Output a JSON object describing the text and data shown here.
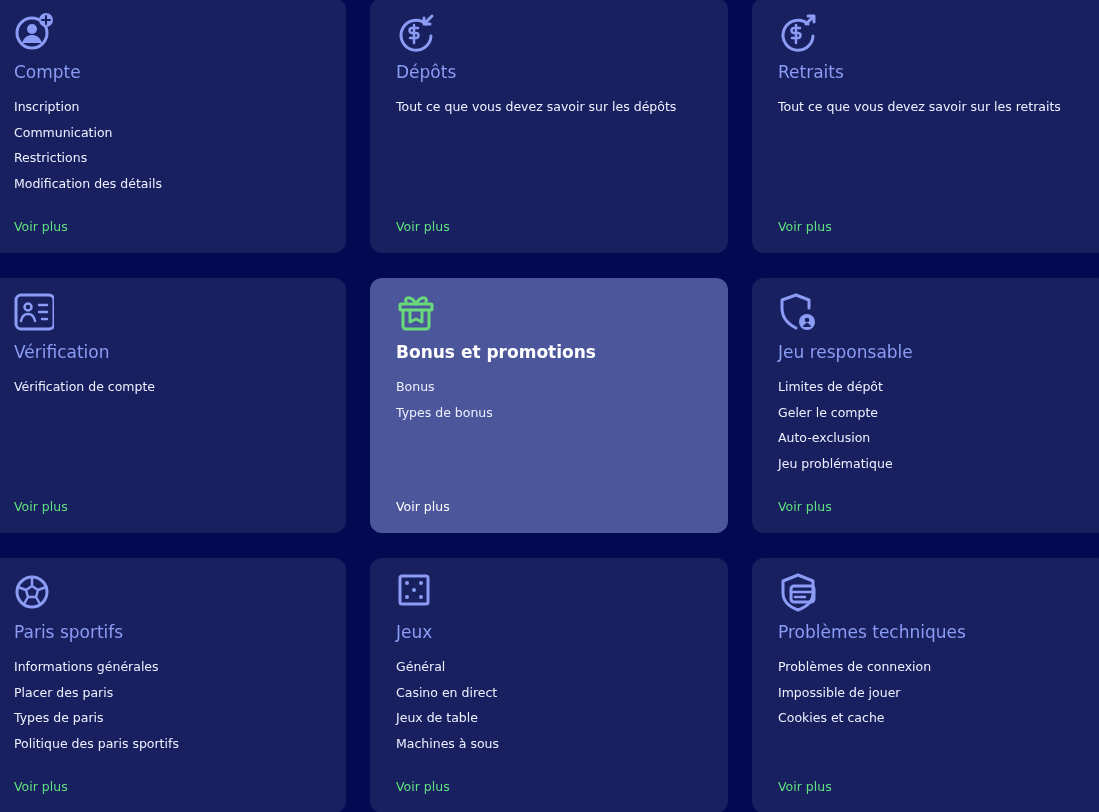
{
  "cards": [
    {
      "title": "Compte",
      "selected": false,
      "links": [
        "Inscription",
        "Communication",
        "Restrictions",
        "Modification des détails"
      ],
      "more": "Voir plus"
    },
    {
      "title": "Dépôts",
      "selected": false,
      "links": [
        "Tout ce que vous devez savoir sur les dépôts"
      ],
      "more": "Voir plus"
    },
    {
      "title": "Retraits",
      "selected": false,
      "links": [
        "Tout ce que vous devez savoir sur les retraits"
      ],
      "more": "Voir plus"
    },
    {
      "title": "Vérification",
      "selected": false,
      "links": [
        "Vérification de compte"
      ],
      "more": "Voir plus"
    },
    {
      "title": "Bonus et promotions",
      "selected": true,
      "links": [
        "Bonus",
        "Types de bonus"
      ],
      "more": "Voir plus"
    },
    {
      "title": "Jeu responsable",
      "selected": false,
      "links": [
        "Limites de dépôt",
        "Geler le compte",
        "Auto-exclusion",
        "Jeu problématique"
      ],
      "more": "Voir plus"
    },
    {
      "title": "Paris sportifs",
      "selected": false,
      "links": [
        "Informations générales",
        "Placer des paris",
        "Types de paris",
        "Politique des paris sportifs"
      ],
      "more": "Voir plus"
    },
    {
      "title": "Jeux",
      "selected": false,
      "links": [
        "Général",
        "Casino en direct",
        "Jeux de table",
        "Machines à sous"
      ],
      "more": "Voir plus"
    },
    {
      "title": "Problèmes techniques",
      "selected": false,
      "links": [
        "Problèmes de connexion",
        "Impossible de jouer",
        "Cookies et cache"
      ],
      "more": "Voir plus"
    }
  ]
}
